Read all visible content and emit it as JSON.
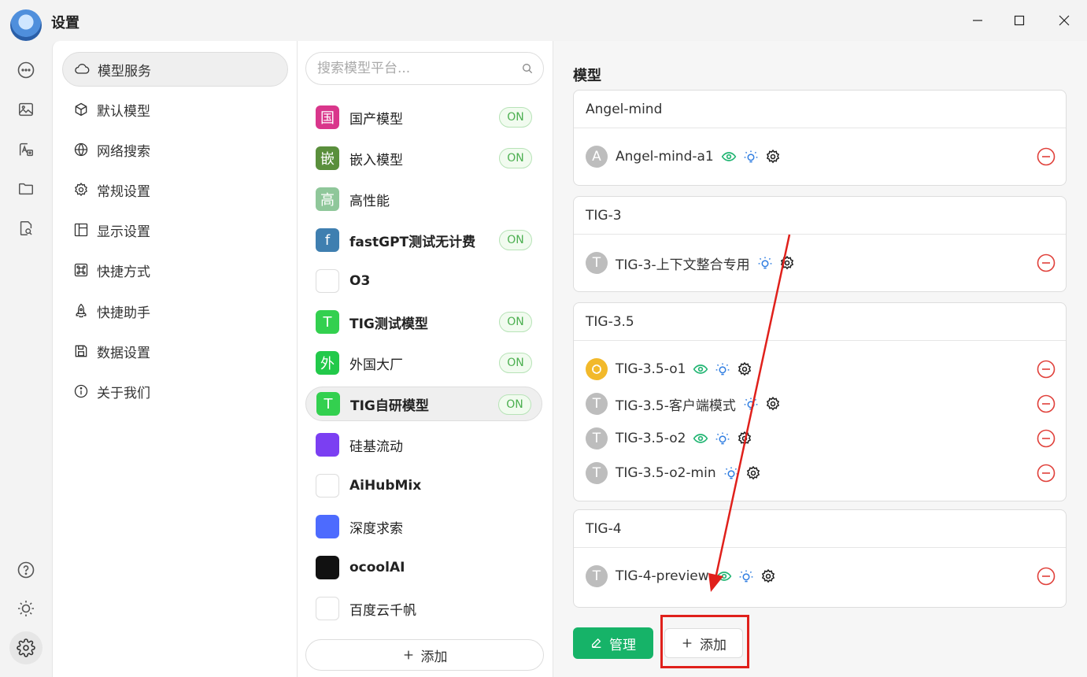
{
  "window": {
    "title": "设置"
  },
  "nav": {
    "items": [
      {
        "label": "模型服务",
        "icon": "cloud-icon"
      },
      {
        "label": "默认模型",
        "icon": "cube-icon"
      },
      {
        "label": "网络搜索",
        "icon": "globe-icon"
      },
      {
        "label": "常规设置",
        "icon": "gear-icon"
      },
      {
        "label": "显示设置",
        "icon": "layout-icon"
      },
      {
        "label": "快捷方式",
        "icon": "command-icon"
      },
      {
        "label": "快捷助手",
        "icon": "rocket-icon"
      },
      {
        "label": "数据设置",
        "icon": "save-icon"
      },
      {
        "label": "关于我们",
        "icon": "info-icon"
      }
    ],
    "active_index": 0
  },
  "providers": {
    "search_placeholder": "搜索模型平台...",
    "on_label": "ON",
    "items": [
      {
        "name": "国产模型",
        "logo_text": "国",
        "color": "#d9368b",
        "on": true
      },
      {
        "name": "嵌入模型",
        "logo_text": "嵌",
        "color": "#5a8f3c",
        "on": true
      },
      {
        "name": "高性能",
        "logo_text": "高",
        "color": "#8fc79a",
        "on": false
      },
      {
        "name": "fastGPT测试无计费",
        "logo_text": "f",
        "color": "#3f7fb0",
        "on": true
      },
      {
        "name": "O3",
        "logo_text": "",
        "color": "#ffffff",
        "on": false
      },
      {
        "name": "TIG测试模型",
        "logo_text": "T",
        "color": "#33d04f",
        "on": true
      },
      {
        "name": "外国大厂",
        "logo_text": "外",
        "color": "#22c94a",
        "on": true
      },
      {
        "name": "TIG自研模型",
        "logo_text": "T",
        "color": "#33d04f",
        "on": true
      },
      {
        "name": "硅基流动",
        "logo_text": "",
        "color": "#7b3ff2",
        "on": false
      },
      {
        "name": "AiHubMix",
        "logo_text": "",
        "color": "#ffffff",
        "on": false
      },
      {
        "name": "深度求索",
        "logo_text": "",
        "color": "#4d6bfe",
        "on": false
      },
      {
        "name": "ocoolAI",
        "logo_text": "",
        "color": "#111111",
        "on": false
      },
      {
        "name": "百度云千帆",
        "logo_text": "",
        "color": "#ffffff",
        "on": false
      }
    ],
    "active_index": 7,
    "add_label": "添加"
  },
  "main": {
    "title": "模型",
    "groups": [
      {
        "name": "Angel-mind",
        "models": [
          {
            "avatar": "A",
            "name": "Angel-mind-a1",
            "vision": true
          }
        ]
      },
      {
        "name": "TIG-3",
        "models": [
          {
            "avatar": "T",
            "name": "TIG-3-上下文整合专用",
            "vision": false
          }
        ]
      },
      {
        "name": "TIG-3.5",
        "models": [
          {
            "avatar": "gpt",
            "name": "TIG-3.5-o1",
            "vision": true
          },
          {
            "avatar": "T",
            "name": "TIG-3.5-客户端模式",
            "vision": false
          },
          {
            "avatar": "T",
            "name": "TIG-3.5-o2",
            "vision": true
          },
          {
            "avatar": "T",
            "name": "TIG-3.5-o2-min",
            "vision": false
          }
        ]
      },
      {
        "name": "TIG-4",
        "models": [
          {
            "avatar": "T",
            "name": "TIG-4-preview",
            "vision": true
          }
        ]
      }
    ],
    "manage_label": "管理",
    "add_label": "添加"
  },
  "colors": {
    "accent_green": "#16b368",
    "on_green": "#4caf50",
    "remove_red": "#e0403a",
    "annotation_red": "#e0201b",
    "vision_green": "#22b573",
    "reasoning_blue": "#2f7de1"
  }
}
